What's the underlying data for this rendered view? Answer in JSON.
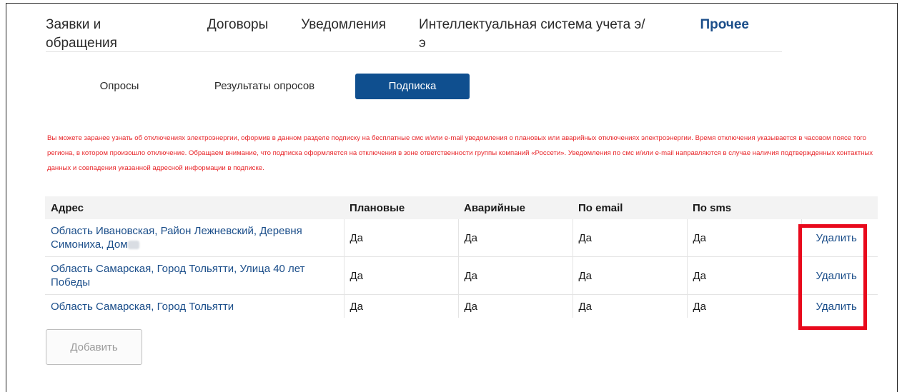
{
  "nav": {
    "items": [
      {
        "label": "Заявки и обращения"
      },
      {
        "label": "Договоры"
      },
      {
        "label": "Уведомления"
      },
      {
        "label": "Интеллектуальная система учета э/э"
      },
      {
        "label": "Прочее",
        "active": true
      }
    ]
  },
  "subtabs": [
    {
      "label": "Опросы"
    },
    {
      "label": "Результаты опросов"
    },
    {
      "label": "Подписка",
      "active": true
    }
  ],
  "notice": {
    "text": "Вы можете заранее узнать об отключениях электроэнергии, оформив в данном разделе подписку на бесплатные смс и/или e-mail уведомления о плановых или аварийных отключениях электроэнергии. Время отключения указывается в часовом поясе того региона, в котором произошло отключение. Обращаем внимание, что подписка оформляется на отключения в зоне ответственности группы компаний «Россети». Уведомления по смс и/или e-mail направляются в случае наличия подтвержденных контактных данных и совпадения указанной адресной информации в подписке.",
    "color": "#e8262a"
  },
  "table": {
    "headers": [
      "Адрес",
      "Плановые",
      "Аварийные",
      "По email",
      "По sms"
    ],
    "rows": [
      {
        "address": "Область Ивановская, Район Лежневский, Деревня Симониха, Дом",
        "planned": "Да",
        "emergency": "Да",
        "email": "Да",
        "sms": "Да",
        "action": "Удалить"
      },
      {
        "address": "Область Самарская, Город Тольятти, Улица 40 лет Победы",
        "planned": "Да",
        "emergency": "Да",
        "email": "Да",
        "sms": "Да",
        "action": "Удалить"
      },
      {
        "address": "Область Самарская, Город Тольятти",
        "planned": "Да",
        "emergency": "Да",
        "email": "Да",
        "sms": "Да",
        "action": "Удалить"
      }
    ]
  },
  "add_button": {
    "label": "Добавить"
  },
  "colors": {
    "accent": "#0f4f8f",
    "link": "#1b4e8a",
    "highlight": "#e8091c"
  }
}
